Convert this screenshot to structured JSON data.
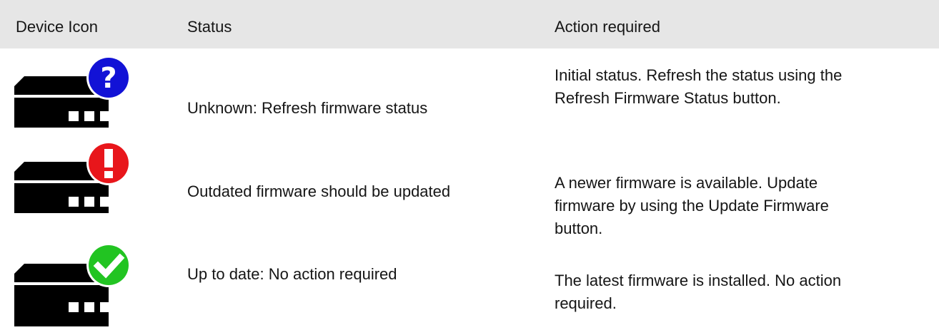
{
  "header": {
    "col_icon": "Device Icon",
    "col_status": "Status",
    "col_action": "Action required"
  },
  "rows": [
    {
      "icon": "device-unknown-icon",
      "badge_color": "#1212d6",
      "status": "Unknown: Refresh firmware status",
      "action_lines": [
        "Initial status. Refresh the status using the",
        "Refresh Firmware Status button."
      ]
    },
    {
      "icon": "device-outdated-icon",
      "badge_color": "#e8161b",
      "status": "Outdated firmware should be updated",
      "action_lines": [
        "A newer firmware is available. Update",
        "firmware by using the Update Firmware",
        "button."
      ]
    },
    {
      "icon": "device-up-to-date-icon",
      "badge_color": "#22c422",
      "status": "Up to date: No action required",
      "action_lines": [
        "The latest firmware is installed. No action",
        "required."
      ]
    }
  ],
  "colors": {
    "header_bg": "#e6e6e6",
    "device_body": "#000000"
  }
}
